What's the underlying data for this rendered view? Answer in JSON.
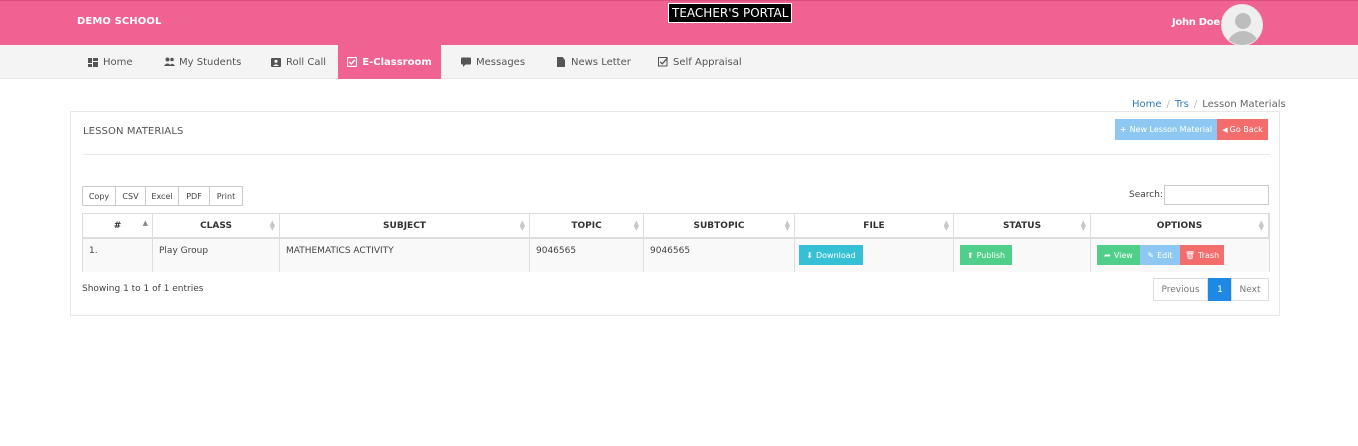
{
  "header": {
    "school_name": "DEMO SCHOOL",
    "portal_title": "TEACHER'S PORTAL",
    "user_name": "John Doe -"
  },
  "nav": {
    "items": [
      {
        "label": "Home",
        "icon": "dashboard-icon"
      },
      {
        "label": "My Students",
        "icon": "people-icon"
      },
      {
        "label": "Roll Call",
        "icon": "id-card-icon"
      },
      {
        "label": "E-Classroom",
        "icon": "checkbox-icon",
        "active": true
      },
      {
        "label": "Messages",
        "icon": "comment-icon"
      },
      {
        "label": "News Letter",
        "icon": "file-icon"
      },
      {
        "label": "Self Appraisal",
        "icon": "check-square-icon"
      }
    ]
  },
  "breadcrumb": {
    "items": [
      "Home",
      "Trs",
      "Lesson Materials"
    ],
    "separator": "/"
  },
  "panel": {
    "title": "LESSON MATERIALS",
    "new_button": "New Lesson Material",
    "back_button": "Go Back"
  },
  "exports": [
    "Copy",
    "CSV",
    "Excel",
    "PDF",
    "Print"
  ],
  "search": {
    "label": "Search:",
    "value": ""
  },
  "table": {
    "columns": [
      "#",
      "CLASS",
      "SUBJECT",
      "TOPIC",
      "SUBTOPIC",
      "FILE",
      "STATUS",
      "OPTIONS"
    ],
    "rows": [
      {
        "num": "1.",
        "class": "Play Group",
        "subject": "MATHEMATICS ACTIVITY",
        "topic": "9046565",
        "subtopic": "9046565",
        "file_button": "Download",
        "status_button": "Publish",
        "options": [
          "View",
          "Edit",
          "Trash"
        ]
      }
    ]
  },
  "footer": {
    "showing": "Showing 1 to 1 of 1 entries",
    "pagination": [
      "Previous",
      "1",
      "Next"
    ]
  },
  "colors": {
    "brand_pink": "#f06292",
    "download_blue": "#35c0d6",
    "publish_green": "#4fcf8a",
    "view_green": "#4fcf8a",
    "edit_blue": "#8ec8f2",
    "trash_red": "#f46d6d",
    "page_active": "#1e88e5"
  }
}
